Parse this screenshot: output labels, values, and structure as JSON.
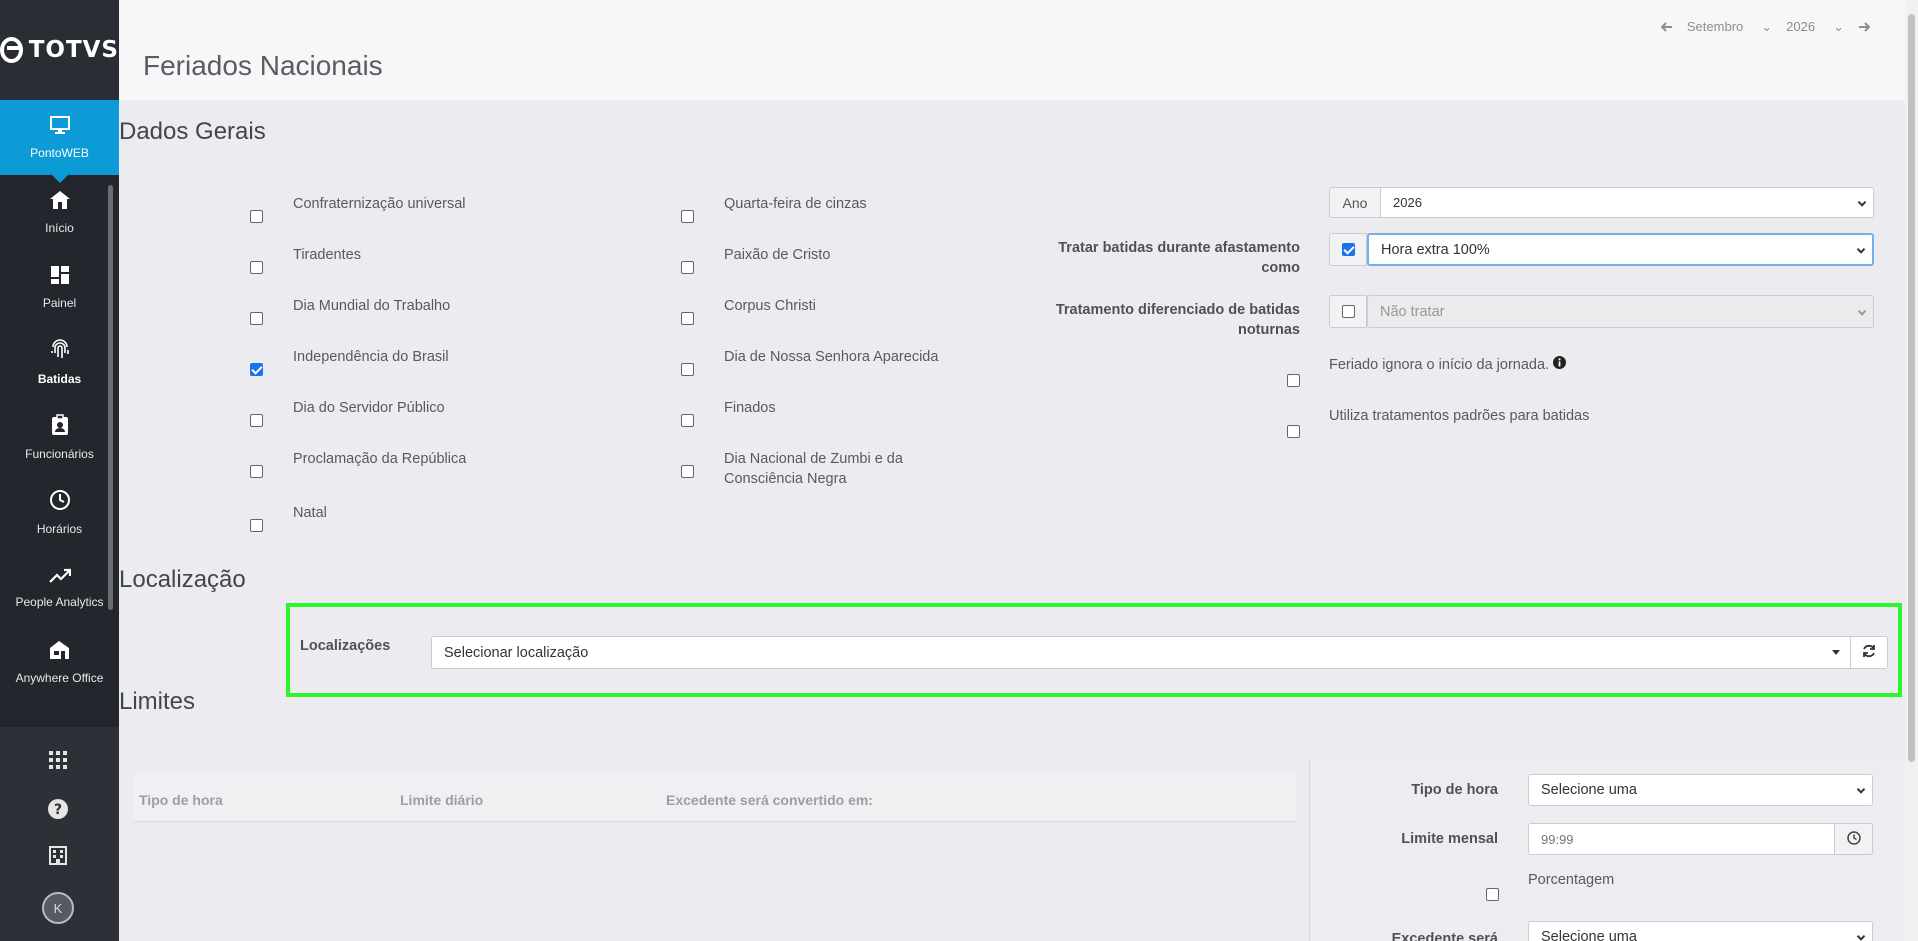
{
  "brand": {
    "name": "TOTVS"
  },
  "sidebar": {
    "items": [
      {
        "label": "PontoWEB",
        "icon": "monitor-icon"
      },
      {
        "label": "Início",
        "icon": "home-icon"
      },
      {
        "label": "Painel",
        "icon": "dashboard-icon"
      },
      {
        "label": "Batidas",
        "icon": "fingerprint-icon"
      },
      {
        "label": "Funcionários",
        "icon": "id-badge-icon"
      },
      {
        "label": "Horários",
        "icon": "clock-icon"
      },
      {
        "label": "People Analytics",
        "icon": "trend-icon"
      },
      {
        "label": "Anywhere Office",
        "icon": "home-office-icon"
      }
    ],
    "avatar_initial": "K"
  },
  "header": {
    "title": "Feriados Nacionais",
    "month": "Setembro",
    "year": "2026"
  },
  "dados_gerais": {
    "title": "Dados Gerais",
    "col1": [
      {
        "label": "Confraternização universal",
        "checked": false
      },
      {
        "label": "Tiradentes",
        "checked": false
      },
      {
        "label": "Dia Mundial do Trabalho",
        "checked": false
      },
      {
        "label": "Independência do Brasil",
        "checked": true
      },
      {
        "label": "Dia do Servidor Público",
        "checked": false
      },
      {
        "label": "Proclamação da República",
        "checked": false
      },
      {
        "label": "Natal",
        "checked": false
      }
    ],
    "col2": [
      {
        "label": "Quarta-feira de cinzas",
        "checked": false
      },
      {
        "label": "Paixão de Cristo",
        "checked": false
      },
      {
        "label": "Corpus Christi",
        "checked": false
      },
      {
        "label": "Dia de Nossa Senhora Aparecida",
        "checked": false
      },
      {
        "label": "Finados",
        "checked": false
      },
      {
        "label": "Dia Nacional de Zumbi e da Consciência Negra",
        "checked": false
      }
    ],
    "ano_label": "Ano",
    "ano_value": "2026",
    "tratar_label": "Tratar batidas durante afastamento como",
    "tratar_value": "Hora extra 100%",
    "noturnas_label": "Tratamento diferenciado de batidas noturnas",
    "noturnas_value": "Não tratar",
    "ignora_label": "Feriado ignora o início da jornada.",
    "padroes_label": "Utiliza tratamentos padrões para batidas"
  },
  "localizacao": {
    "title": "Localização",
    "label": "Localizações",
    "placeholder": "Selecionar localização"
  },
  "limites": {
    "title": "Limites",
    "columns": [
      "Tipo de hora",
      "Limite diário",
      "Excedente será convertido em:"
    ],
    "tipo_label": "Tipo de hora",
    "tipo_value": "Selecione uma",
    "mensal_label": "Limite mensal",
    "mensal_placeholder": "99:99",
    "porcentagem_label": "Porcentagem",
    "excedente_label": "Excedente será",
    "excedente_value": "Selecione uma"
  }
}
